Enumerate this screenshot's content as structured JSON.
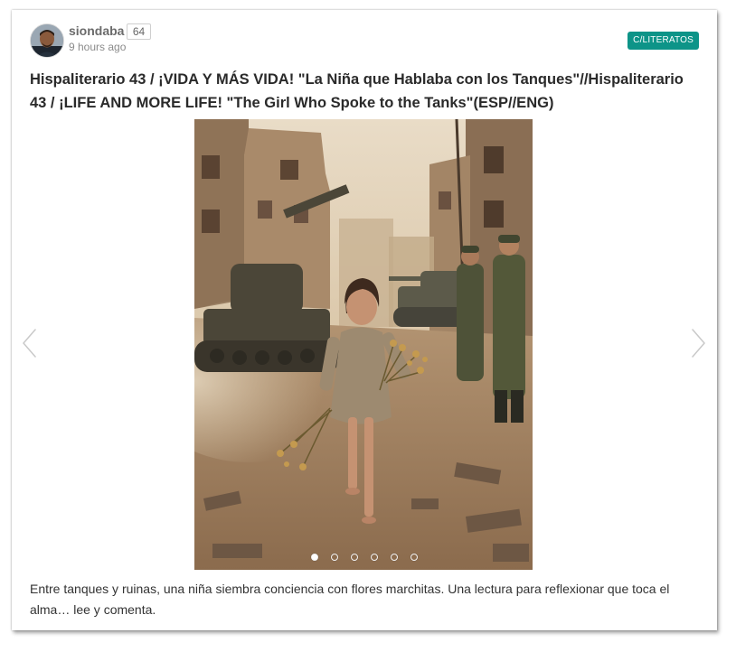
{
  "post": {
    "author": "siondaba",
    "reputation": "64",
    "time_ago": "9 hours ago",
    "community": "C/LITERATOS",
    "title": "Hispaliterario 43 / ¡VIDA Y MÁS VIDA! \"La Niña que Hablaba con los Tanques\"//Hispaliterario 43 / ¡LIFE AND MORE LIFE! \"The Girl Who Spoke to the Tanks\"(ESP//ENG)",
    "summary": "Entre tanques y ruinas, una niña siembra conciencia con flores marchitas. Una lectura para reflexionar que toca el alma… lee y comenta."
  },
  "carousel": {
    "slides": 6,
    "active_index": 0
  },
  "colors": {
    "badge": "#0d9488",
    "title": "#2a2a2a",
    "muted": "#8b8b8b"
  },
  "icons": {
    "prev": "chevron-left-icon",
    "next": "chevron-right-icon"
  }
}
